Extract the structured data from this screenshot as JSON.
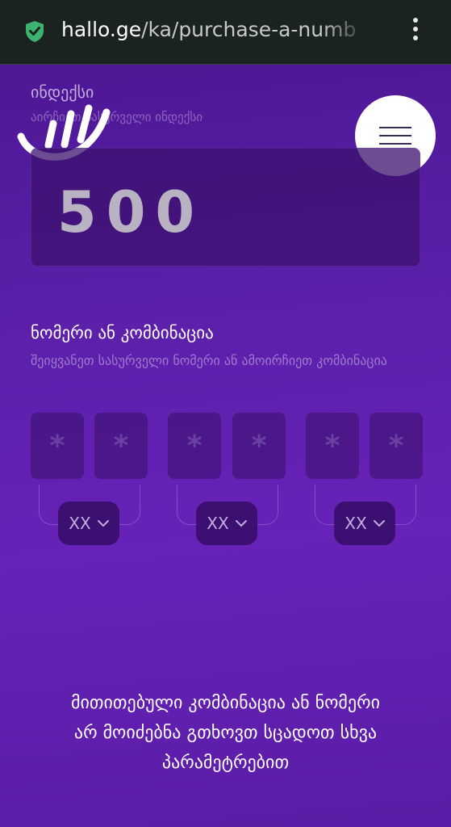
{
  "browser": {
    "url_domain": "hallo.ge",
    "url_path": "/ka/purchase-a-numb",
    "secure_icon": "shield-check-icon",
    "menu_icon": "more-vert-icon"
  },
  "header": {
    "logo_icon": "hallo-logo-icon",
    "menu_icon": "hamburger-menu-icon"
  },
  "index_section": {
    "title": "ინდექსი",
    "hint": "აირჩიეთ სასურველი ინდექსი",
    "value": "500"
  },
  "number_section": {
    "title": "ნომერი ან კომბინაცია",
    "hint": "შეიყვანეთ სასურველი ნომერი ან ამოირჩიეთ კომბინაცია",
    "digit_placeholder": "*",
    "groups": [
      {
        "digits": [
          "*",
          "*"
        ],
        "select": "XX"
      },
      {
        "digits": [
          "*",
          "*"
        ],
        "select": "XX"
      },
      {
        "digits": [
          "*",
          "*"
        ],
        "select": "XX"
      }
    ]
  },
  "message": {
    "line1": "მითითებული კომბინაცია ან ნომერი",
    "line2": "არ მოიძებნა გთხოვთ სცადოთ სხვა",
    "line3": "პარამეტრებით"
  },
  "colors": {
    "background": "#5a1fa8",
    "browser_bar": "#1b2320",
    "secure": "#3cb371",
    "accent_white": "#ffffff"
  }
}
